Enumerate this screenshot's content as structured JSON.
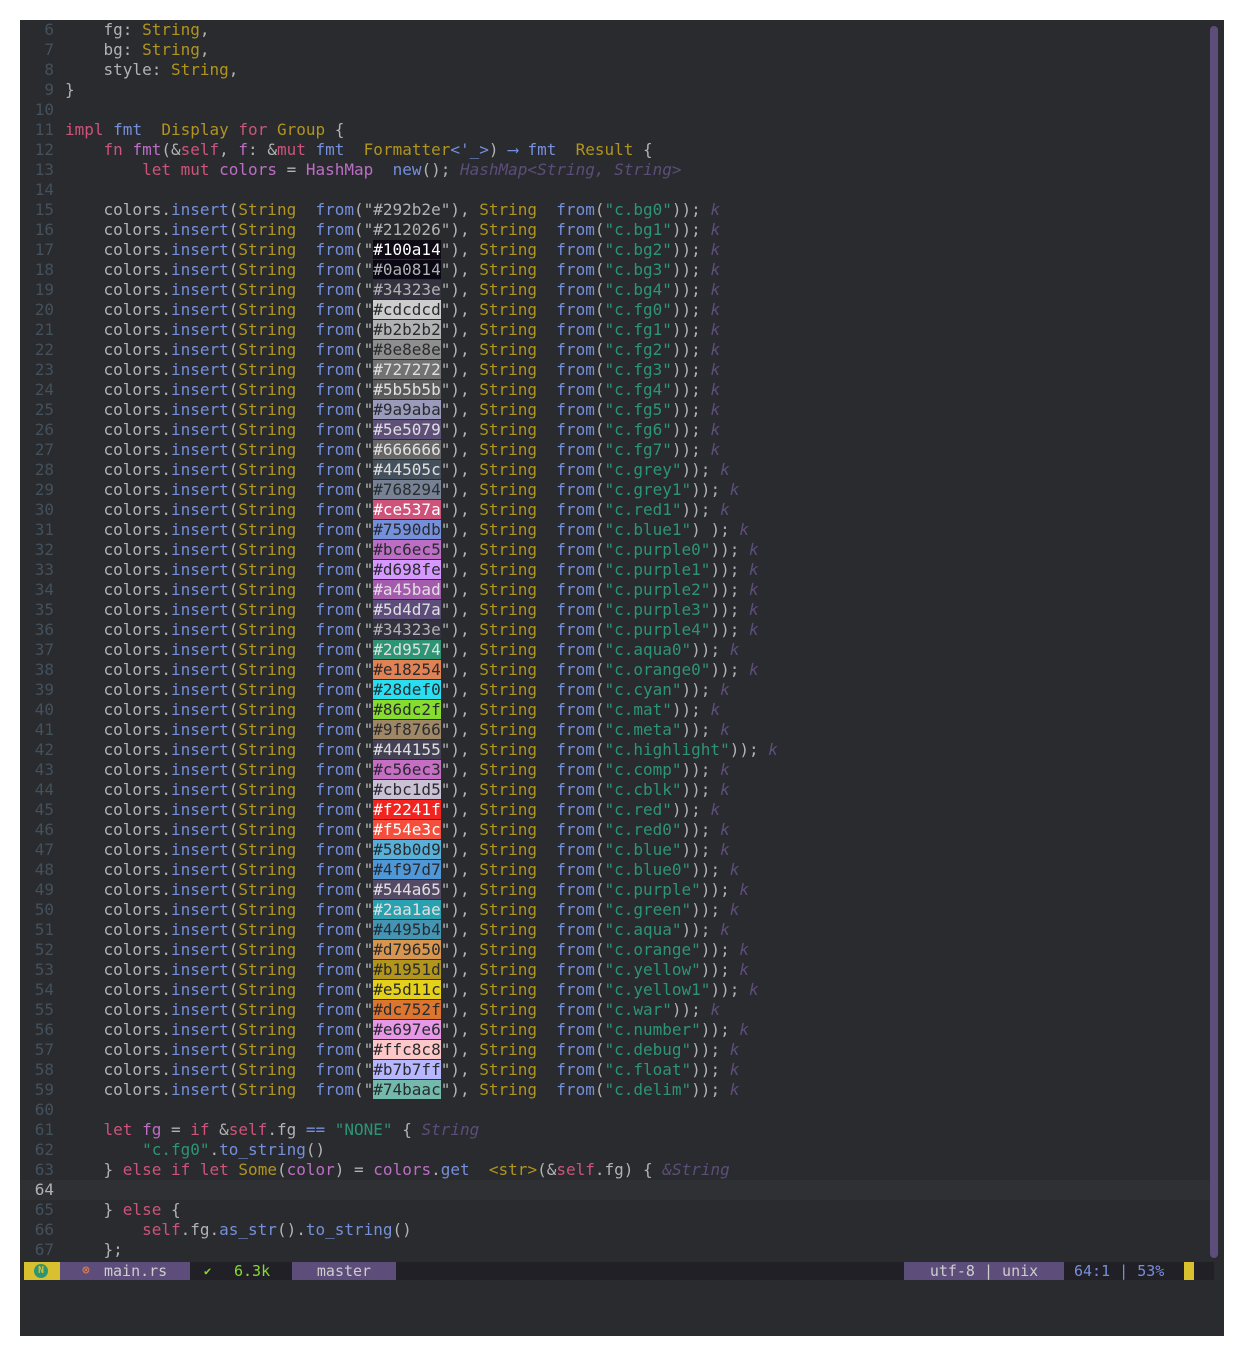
{
  "editor": {
    "current_line": 64,
    "lines": [
      {
        "n": "6",
        "html": "    <span>fg</span>: <span class=\"t\">String</span>,"
      },
      {
        "n": "7",
        "html": "    <span>bg</span>: <span class=\"t\">String</span>,"
      },
      {
        "n": "8",
        "html": "    <span>style</span>: <span class=\"t\">String</span>,"
      },
      {
        "n": "9",
        "html": "}"
      },
      {
        "n": "10",
        "html": ""
      },
      {
        "n": "11",
        "html": "<span class=\"k\">impl</span> <span class=\"m\">fmt</span>  <span class=\"t\">Display</span> <span class=\"k\">for</span> <span class=\"t\">Group</span> {"
      },
      {
        "n": "12",
        "html": "    <span class=\"k\">fn</span> <span class=\"f\">fmt</span>(&amp;<span class=\"k\">self</span>, <span class=\"f\">f</span>: &amp;<span class=\"k\">mut</span> <span class=\"m\">fmt</span>  <span class=\"t\">Formatter</span><span class=\"m\">&lt;'_&gt;</span>) <span class=\"m\">⟶</span> <span class=\"m\">fmt</span>  <span class=\"t\">Result</span> {"
      },
      {
        "n": "13",
        "html": "        <span class=\"k\">let</span> <span class=\"k\">mut</span> <span class=\"f\">colors</span> = <span class=\"f\">HashMap</span>  <span class=\"m\">new</span>(); <span class=\"i\">HashMap&lt;String, String&gt;</span>"
      },
      {
        "n": "14",
        "html": ""
      }
    ],
    "rows": [
      {
        "n": "15",
        "hex": "#292b2e",
        "name": "c.bg0",
        "fg": "#b2b2b2",
        "bg": "transparent",
        "close": "));"
      },
      {
        "n": "16",
        "hex": "#212026",
        "name": "c.bg1",
        "fg": "#b2b2b2",
        "bg": "transparent",
        "close": "));"
      },
      {
        "n": "17",
        "hex": "#100a14",
        "name": "c.bg2",
        "fg": "#ffffff",
        "bg": "#100a14",
        "close": "));"
      },
      {
        "n": "18",
        "hex": "#0a0814",
        "name": "c.bg3",
        "fg": "#b2b2b2",
        "bg": "#0a0814",
        "close": "));"
      },
      {
        "n": "19",
        "hex": "#34323e",
        "name": "c.bg4",
        "fg": "#b2b2b2",
        "bg": "#34323e",
        "close": "));"
      },
      {
        "n": "20",
        "hex": "#cdcdcd",
        "name": "c.fg0",
        "fg": "#292b2e",
        "bg": "#cdcdcd",
        "close": "));"
      },
      {
        "n": "21",
        "hex": "#b2b2b2",
        "name": "c.fg1",
        "fg": "#292b2e",
        "bg": "#b2b2b2",
        "close": "));"
      },
      {
        "n": "22",
        "hex": "#8e8e8e",
        "name": "c.fg2",
        "fg": "#292b2e",
        "bg": "#8e8e8e",
        "close": "));"
      },
      {
        "n": "23",
        "hex": "#727272",
        "name": "c.fg3",
        "fg": "#e0e0e0",
        "bg": "#727272",
        "close": "));"
      },
      {
        "n": "24",
        "hex": "#5b5b5b",
        "name": "c.fg4",
        "fg": "#e0e0e0",
        "bg": "#5b5b5b",
        "close": "));"
      },
      {
        "n": "25",
        "hex": "#9a9aba",
        "name": "c.fg5",
        "fg": "#292b2e",
        "bg": "#9a9aba",
        "close": "));"
      },
      {
        "n": "26",
        "hex": "#5e5079",
        "name": "c.fg6",
        "fg": "#e0e0e0",
        "bg": "#5e5079",
        "close": "));"
      },
      {
        "n": "27",
        "hex": "#666666",
        "name": "c.fg7",
        "fg": "#e0e0e0",
        "bg": "#666666",
        "close": "));"
      },
      {
        "n": "28",
        "hex": "#44505c",
        "name": "c.grey",
        "fg": "#e0e0e0",
        "bg": "#44505c",
        "close": "));"
      },
      {
        "n": "29",
        "hex": "#768294",
        "name": "c.grey1",
        "fg": "#292b2e",
        "bg": "#768294",
        "close": "));"
      },
      {
        "n": "30",
        "hex": "#ce537a",
        "name": "c.red1",
        "fg": "#ffffff",
        "bg": "#ce537a",
        "close": "));"
      },
      {
        "n": "31",
        "hex": "#7590db",
        "name": "c.blue1",
        "fg": "#292b2e",
        "bg": "#7590db",
        "close": ") );"
      },
      {
        "n": "32",
        "hex": "#bc6ec5",
        "name": "c.purple0",
        "fg": "#292b2e",
        "bg": "#bc6ec5",
        "close": "));"
      },
      {
        "n": "33",
        "hex": "#d698fe",
        "name": "c.purple1",
        "fg": "#292b2e",
        "bg": "#d698fe",
        "close": "));"
      },
      {
        "n": "34",
        "hex": "#a45bad",
        "name": "c.purple2",
        "fg": "#e0e0e0",
        "bg": "#a45bad",
        "close": "));"
      },
      {
        "n": "35",
        "hex": "#5d4d7a",
        "name": "c.purple3",
        "fg": "#e0e0e0",
        "bg": "#5d4d7a",
        "close": "));"
      },
      {
        "n": "36",
        "hex": "#34323e",
        "name": "c.purple4",
        "fg": "#b2b2b2",
        "bg": "#34323e",
        "close": "));"
      },
      {
        "n": "37",
        "hex": "#2d9574",
        "name": "c.aqua0",
        "fg": "#e0e0e0",
        "bg": "#2d9574",
        "close": "));"
      },
      {
        "n": "38",
        "hex": "#e18254",
        "name": "c.orange0",
        "fg": "#292b2e",
        "bg": "#e18254",
        "close": "));"
      },
      {
        "n": "39",
        "hex": "#28def0",
        "name": "c.cyan",
        "fg": "#292b2e",
        "bg": "#28def0",
        "close": "));"
      },
      {
        "n": "40",
        "hex": "#86dc2f",
        "name": "c.mat",
        "fg": "#292b2e",
        "bg": "#86dc2f",
        "close": "));"
      },
      {
        "n": "41",
        "hex": "#9f8766",
        "name": "c.meta",
        "fg": "#292b2e",
        "bg": "#9f8766",
        "close": "));"
      },
      {
        "n": "42",
        "hex": "#444155",
        "name": "c.highlight",
        "fg": "#e0e0e0",
        "bg": "#444155",
        "close": "));"
      },
      {
        "n": "43",
        "hex": "#c56ec3",
        "name": "c.comp",
        "fg": "#292b2e",
        "bg": "#c56ec3",
        "close": "));"
      },
      {
        "n": "44",
        "hex": "#cbc1d5",
        "name": "c.cblk",
        "fg": "#292b2e",
        "bg": "#cbc1d5",
        "close": "));"
      },
      {
        "n": "45",
        "hex": "#f2241f",
        "name": "c.red",
        "fg": "#ffffff",
        "bg": "#f2241f",
        "close": "));"
      },
      {
        "n": "46",
        "hex": "#f54e3c",
        "name": "c.red0",
        "fg": "#ffffff",
        "bg": "#f54e3c",
        "close": "));"
      },
      {
        "n": "47",
        "hex": "#58b0d9",
        "name": "c.blue",
        "fg": "#292b2e",
        "bg": "#58b0d9",
        "close": "));"
      },
      {
        "n": "48",
        "hex": "#4f97d7",
        "name": "c.blue0",
        "fg": "#292b2e",
        "bg": "#4f97d7",
        "close": "));"
      },
      {
        "n": "49",
        "hex": "#544a65",
        "name": "c.purple",
        "fg": "#e0e0e0",
        "bg": "#544a65",
        "close": "));"
      },
      {
        "n": "50",
        "hex": "#2aa1ae",
        "name": "c.green",
        "fg": "#e0e0e0",
        "bg": "#2aa1ae",
        "close": "));"
      },
      {
        "n": "51",
        "hex": "#4495b4",
        "name": "c.aqua",
        "fg": "#292b2e",
        "bg": "#4495b4",
        "close": "));"
      },
      {
        "n": "52",
        "hex": "#d79650",
        "name": "c.orange",
        "fg": "#292b2e",
        "bg": "#d79650",
        "close": "));"
      },
      {
        "n": "53",
        "hex": "#b1951d",
        "name": "c.yellow",
        "fg": "#292b2e",
        "bg": "#b1951d",
        "close": "));"
      },
      {
        "n": "54",
        "hex": "#e5d11c",
        "name": "c.yellow1",
        "fg": "#292b2e",
        "bg": "#e5d11c",
        "close": "));"
      },
      {
        "n": "55",
        "hex": "#dc752f",
        "name": "c.war",
        "fg": "#292b2e",
        "bg": "#dc752f",
        "close": "));"
      },
      {
        "n": "56",
        "hex": "#e697e6",
        "name": "c.number",
        "fg": "#292b2e",
        "bg": "#e697e6",
        "close": "));"
      },
      {
        "n": "57",
        "hex": "#ffc8c8",
        "name": "c.debug",
        "fg": "#292b2e",
        "bg": "#ffc8c8",
        "close": "));"
      },
      {
        "n": "58",
        "hex": "#b7b7ff",
        "name": "c.float",
        "fg": "#292b2e",
        "bg": "#b7b7ff",
        "close": "));"
      },
      {
        "n": "59",
        "hex": "#74baac",
        "name": "c.delim",
        "fg": "#292b2e",
        "bg": "#74baac",
        "close": "));"
      }
    ],
    "tail": [
      {
        "n": "60",
        "html": ""
      },
      {
        "n": "61",
        "html": "    <span class=\"k\">let</span> <span class=\"f\">fg</span> = <span class=\"k\">if</span> &amp;<span class=\"k\">self</span>.<span>fg</span> <span class=\"m\">==</span> <span class=\"s\">\"NONE\"</span> { <span class=\"i\">String</span>"
      },
      {
        "n": "62",
        "html": "        <span class=\"s\">\"c.fg0\"</span>.<span class=\"m\">to_string</span>()"
      },
      {
        "n": "63",
        "html": "    } <span class=\"k\">else</span> <span class=\"k\">if</span> <span class=\"k\">let</span> <span class=\"t\">Some</span>(<span class=\"f\">color</span>) = <span class=\"f\">colors</span>.<span class=\"m\">get</span>  <span class=\"t\">&lt;str&gt;</span>(&amp;<span class=\"k\">self</span>.<span>fg</span>) { <span class=\"i\">&amp;String</span>"
      },
      {
        "n": "64",
        "html": ""
      },
      {
        "n": "65",
        "html": "    } <span class=\"k\">else</span> {"
      },
      {
        "n": "66",
        "html": "        <span class=\"k\">self</span>.<span>fg</span>.<span class=\"m\">as_str</span>().<span class=\"m\">to_string</span>()"
      },
      {
        "n": "67",
        "html": "    };"
      }
    ],
    "hint": "k",
    "tokens": {
      "prefix": "colors.",
      "insert": "insert",
      "string": "String",
      "from": "from"
    }
  },
  "statusbar": {
    "mode": "N",
    "file_icon": "⊗",
    "file_name": "main.rs",
    "check_icon": "✔",
    "file_size": "6.3k",
    "branch": "master",
    "encoding": "utf-8 | unix",
    "position": "64:1 | 53%"
  },
  "colors": {
    "bg": "#292b2e",
    "keyword": "#ce537a",
    "type": "#b1951d",
    "string": "#2d9574",
    "func": "#bc6ec5",
    "method": "#7590db",
    "accent": "#5d4d7a",
    "mode": "#d8c02f"
  }
}
